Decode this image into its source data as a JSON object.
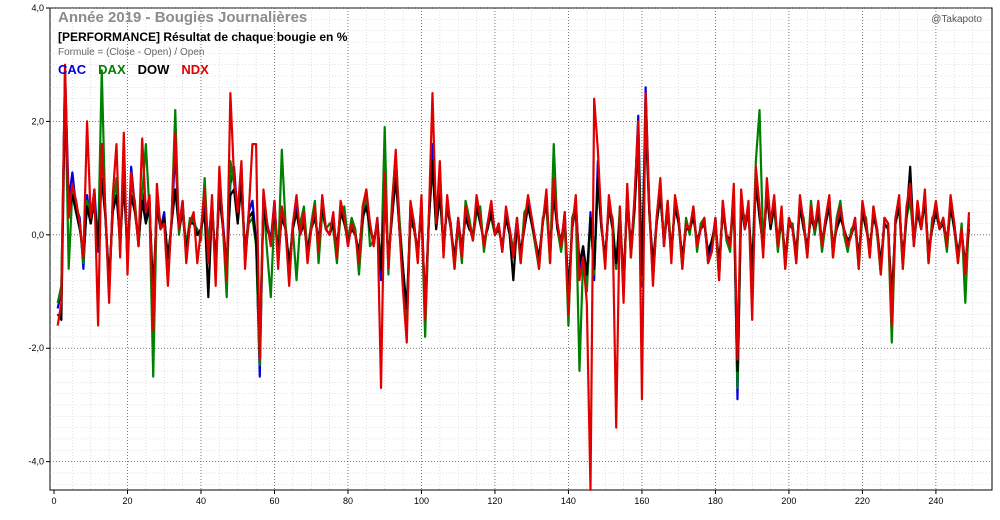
{
  "title": "Année 2019 - Bougies Journalières",
  "subtitle": "[PERFORMANCE] Résultat de chaque bougie en %",
  "formula": "Formule = (Close - Open) / Open",
  "watermark": "@Takapoto",
  "colors": {
    "CAC": "#0000dd",
    "DAX": "#008000",
    "DOW": "#000000",
    "NDX": "#e00000",
    "grid": "#c8c8c8",
    "grid_major": "#555555"
  },
  "chart_data": {
    "type": "line",
    "title": "Année 2019 - Bougies Journalières",
    "subtitle": "[PERFORMANCE] Résultat de chaque bougie en %",
    "xlim": [
      0,
      252
    ],
    "ylim": [
      -4.5,
      4.0
    ],
    "x_ticks": [
      0,
      20,
      40,
      60,
      80,
      100,
      120,
      140,
      160,
      180,
      200,
      220,
      240
    ],
    "y_ticks": [
      -4.0,
      -2.0,
      0.0,
      2.0,
      4.0
    ],
    "y_tick_labels": [
      "-4,0",
      "-2,0",
      "0,0",
      "2,0",
      "4,0"
    ],
    "grid": true,
    "legend_position": "top-left",
    "series": [
      {
        "name": "CAC",
        "color": "#0000dd",
        "values": [
          -1.3,
          -1.0,
          2.9,
          0.6,
          1.1,
          0.5,
          0.3,
          -0.6,
          0.7,
          0.2,
          0.8,
          -0.3,
          1.6,
          0.4,
          -1.0,
          0.6,
          0.9,
          -0.2,
          1.2,
          -0.5,
          1.2,
          0.5,
          -0.2,
          0.8,
          0.3,
          0.6,
          -1.4,
          0.7,
          0.1,
          0.4,
          -0.6,
          0.2,
          1.5,
          0.1,
          0.6,
          -0.4,
          0.2,
          0.3,
          0.0,
          0.1,
          0.5,
          -0.2,
          0.6,
          -0.7,
          1.0,
          0.2,
          -0.6,
          0.9,
          1.2,
          0.3,
          1.2,
          -0.5,
          0.4,
          0.6,
          -0.1,
          -2.5,
          0.7,
          0.2,
          -0.1,
          0.6,
          -0.5,
          0.4,
          0.1,
          -0.7,
          0.2,
          0.5,
          0.0,
          0.3,
          -0.4,
          0.1,
          0.4,
          -0.2,
          0.6,
          0.1,
          0.0,
          0.3,
          -0.3,
          0.5,
          0.3,
          -0.2,
          0.2,
          0.0,
          -0.4,
          0.4,
          0.6,
          0.2,
          -0.2,
          0.3,
          -0.8,
          0.9,
          -0.5,
          0.4,
          1.2,
          0.1,
          -0.8,
          -1.7,
          0.5,
          0.2,
          -0.4,
          0.6,
          -1.5,
          0.3,
          1.6,
          0.2,
          0.9,
          -0.3,
          0.6,
          0.1,
          -0.5,
          0.3,
          -0.3,
          0.4,
          0.2,
          -0.1,
          0.6,
          0.3,
          -0.2,
          0.2,
          0.5,
          0.0,
          0.2,
          -0.3,
          0.4,
          0.1,
          -0.3,
          0.3,
          -0.4,
          0.2,
          0.6,
          0.3,
          -0.1,
          -0.5,
          0.2,
          0.7,
          -0.4,
          0.9,
          0.2,
          -0.2,
          0.4,
          -1.2,
          0.1,
          0.6,
          -0.6,
          -0.3,
          -0.9,
          0.4,
          -0.8,
          1.3,
          0.2,
          -0.5,
          0.6,
          0.2,
          -0.6,
          0.4,
          -1.0,
          0.8,
          -0.3,
          0.6,
          2.1,
          -0.9,
          2.6,
          0.5,
          -0.7,
          0.3,
          0.9,
          -0.2,
          0.5,
          -0.4,
          0.6,
          0.3,
          -0.5,
          0.2,
          0.1,
          0.4,
          -0.2,
          0.1,
          0.2,
          -0.4,
          -0.2,
          0.3,
          -0.7,
          0.5,
          0.0,
          -0.2,
          0.8,
          -2.9,
          0.7,
          0.1,
          0.5,
          -0.8,
          1.1,
          0.4,
          -0.3,
          0.9,
          0.2,
          0.6,
          -0.2,
          0.4,
          -0.5,
          0.3,
          0.1,
          -0.4,
          0.6,
          0.2,
          -0.3,
          0.4,
          0.1,
          0.5,
          -0.2,
          0.3,
          0.6,
          -0.3,
          0.2,
          0.4,
          0.1,
          -0.2,
          0.0,
          0.3,
          -0.5,
          0.5,
          0.2,
          -0.3,
          0.4,
          0.1,
          -0.6,
          0.3,
          0.2,
          -1.4,
          0.3,
          0.6,
          -0.5,
          0.4,
          0.8,
          -0.2,
          0.5,
          0.1,
          0.7,
          -0.4,
          0.2,
          0.5,
          0.1,
          0.3,
          -0.2,
          0.6,
          0.2,
          -0.4,
          0.1,
          -0.6,
          0.2
        ]
      },
      {
        "name": "DAX",
        "color": "#008000",
        "values": [
          -1.2,
          -0.9,
          2.7,
          -0.6,
          0.8,
          0.6,
          0.2,
          -0.5,
          0.6,
          0.3,
          0.5,
          -0.2,
          2.9,
          0.3,
          -1.0,
          0.5,
          1.0,
          -0.3,
          1.3,
          -0.4,
          0.9,
          0.6,
          -0.2,
          0.7,
          1.6,
          0.4,
          -2.5,
          0.6,
          0.2,
          0.2,
          -0.8,
          0.3,
          2.2,
          0.0,
          0.5,
          -0.2,
          0.3,
          0.2,
          0.1,
          -0.1,
          1.0,
          -0.3,
          0.6,
          -0.6,
          0.9,
          0.1,
          -1.1,
          1.3,
          0.9,
          0.4,
          0.8,
          -0.4,
          0.2,
          0.3,
          -0.2,
          -2.3,
          0.6,
          -0.3,
          -1.1,
          0.4,
          -0.4,
          1.5,
          0.2,
          -0.6,
          0.1,
          -0.8,
          0.2,
          0.5,
          -0.3,
          0.2,
          0.6,
          -0.5,
          0.4,
          0.1,
          0.2,
          0.1,
          -0.5,
          0.4,
          0.5,
          -0.1,
          0.3,
          0.1,
          -0.7,
          0.2,
          0.8,
          -0.2,
          -0.1,
          0.2,
          -0.6,
          1.9,
          -0.7,
          0.6,
          1.4,
          0.3,
          -0.6,
          -1.5,
          0.2,
          0.1,
          -0.3,
          0.5,
          -1.8,
          0.3,
          1.2,
          0.1,
          1.1,
          -0.2,
          0.5,
          0.2,
          -0.6,
          0.2,
          -0.5,
          0.6,
          0.3,
          -0.1,
          0.4,
          0.5,
          -0.3,
          0.2,
          0.3,
          0.0,
          0.1,
          -0.2,
          0.3,
          0.1,
          -0.3,
          0.2,
          -0.5,
          0.4,
          0.5,
          0.2,
          -0.2,
          -0.6,
          0.3,
          0.5,
          -0.5,
          1.6,
          0.1,
          -0.3,
          0.2,
          -1.6,
          0.3,
          0.5,
          -2.4,
          -0.4,
          -1.0,
          0.3,
          -0.7,
          0.9,
          0.1,
          -0.4,
          0.5,
          0.3,
          -0.6,
          0.5,
          -1.0,
          0.7,
          -0.4,
          0.4,
          1.9,
          -0.8,
          2.4,
          0.4,
          -0.8,
          0.2,
          0.7,
          -0.1,
          0.6,
          -0.3,
          0.5,
          0.2,
          -0.6,
          0.3,
          0.0,
          0.5,
          -0.3,
          0.2,
          0.3,
          -0.5,
          -0.3,
          0.2,
          -0.8,
          0.6,
          -0.1,
          -0.3,
          0.7,
          -2.7,
          0.5,
          0.3,
          0.4,
          -0.7,
          1.3,
          2.2,
          -0.2,
          0.7,
          0.3,
          0.5,
          -0.3,
          0.3,
          -0.6,
          0.2,
          0.2,
          -0.5,
          0.5,
          0.3,
          -0.4,
          0.6,
          0.0,
          0.4,
          -0.3,
          0.2,
          0.5,
          -0.4,
          0.3,
          0.6,
          0.0,
          -0.3,
          0.1,
          0.2,
          -0.6,
          0.4,
          0.3,
          -0.4,
          0.5,
          0.0,
          -0.7,
          0.2,
          0.1,
          -1.9,
          0.2,
          0.5,
          -0.6,
          0.3,
          0.6,
          -0.1,
          0.4,
          0.2,
          0.6,
          -0.5,
          0.3,
          0.4,
          0.2,
          0.2,
          -0.3,
          0.5,
          0.1,
          -0.5,
          0.2,
          -1.2,
          0.3
        ]
      },
      {
        "name": "DOW",
        "color": "#000000",
        "values": [
          -1.4,
          -1.5,
          2.5,
          0.4,
          0.7,
          0.4,
          0.1,
          -0.3,
          0.5,
          0.2,
          0.6,
          -0.2,
          1.0,
          0.3,
          -0.8,
          0.4,
          0.7,
          -0.1,
          0.9,
          -0.3,
          0.7,
          0.4,
          -0.1,
          0.6,
          0.2,
          0.5,
          -1.0,
          0.5,
          0.1,
          0.3,
          -0.4,
          0.2,
          0.8,
          0.1,
          0.4,
          -0.3,
          0.2,
          0.2,
          0.0,
          0.1,
          0.4,
          -1.1,
          0.5,
          -0.5,
          0.7,
          0.1,
          -0.5,
          0.7,
          0.8,
          0.2,
          0.9,
          -0.3,
          0.3,
          0.4,
          -0.1,
          -1.8,
          0.5,
          0.1,
          -0.1,
          0.4,
          -0.3,
          0.3,
          0.1,
          -0.5,
          0.1,
          0.4,
          0.0,
          0.2,
          -0.3,
          0.1,
          0.3,
          -0.1,
          0.5,
          0.1,
          0.0,
          0.2,
          -0.2,
          0.4,
          0.2,
          -0.1,
          0.1,
          0.0,
          -0.3,
          0.3,
          0.5,
          0.1,
          -0.1,
          0.2,
          -0.6,
          0.7,
          -0.4,
          0.3,
          1.0,
          0.1,
          -0.6,
          -1.3,
          0.4,
          0.1,
          -0.3,
          0.4,
          -1.2,
          0.2,
          1.3,
          0.1,
          0.7,
          -0.2,
          0.5,
          0.1,
          -0.4,
          0.2,
          -0.2,
          0.3,
          0.1,
          0.0,
          0.5,
          0.2,
          -0.1,
          0.1,
          0.4,
          0.0,
          0.1,
          -0.2,
          0.3,
          0.0,
          -0.8,
          0.2,
          -0.3,
          0.1,
          0.5,
          0.2,
          -0.1,
          -0.4,
          0.2,
          0.6,
          -0.3,
          0.7,
          0.1,
          -0.1,
          0.3,
          -1.0,
          0.1,
          0.5,
          -0.5,
          -0.2,
          -0.7,
          0.3,
          -0.6,
          1.0,
          0.1,
          -0.4,
          0.5,
          0.1,
          -0.5,
          0.3,
          -0.8,
          0.6,
          -0.2,
          0.5,
          1.6,
          -0.7,
          2.0,
          0.4,
          -0.5,
          0.2,
          0.7,
          -0.1,
          0.4,
          -0.3,
          0.5,
          0.2,
          -0.4,
          0.1,
          0.1,
          0.3,
          -0.1,
          0.1,
          0.2,
          -0.3,
          -0.1,
          0.2,
          -0.5,
          0.4,
          0.0,
          -0.1,
          0.6,
          -2.4,
          0.5,
          0.1,
          0.4,
          -0.6,
          0.9,
          0.3,
          -0.2,
          0.7,
          0.1,
          0.5,
          -0.1,
          0.3,
          -0.4,
          0.2,
          0.1,
          -0.3,
          0.5,
          0.1,
          -0.2,
          0.3,
          0.1,
          0.4,
          -0.1,
          0.2,
          0.5,
          -0.2,
          0.1,
          0.3,
          0.1,
          -0.1,
          0.0,
          0.2,
          -0.4,
          0.4,
          0.1,
          -0.2,
          0.3,
          0.1,
          -0.5,
          0.2,
          0.1,
          -1.1,
          0.2,
          0.5,
          -0.4,
          0.3,
          1.2,
          -0.1,
          0.4,
          0.1,
          0.6,
          -0.3,
          0.1,
          0.4,
          0.1,
          0.2,
          -0.1,
          0.5,
          0.1,
          -0.3,
          0.0,
          -0.5,
          0.1
        ]
      },
      {
        "name": "NDX",
        "color": "#e00000",
        "values": [
          -1.6,
          -1.2,
          3.0,
          0.3,
          0.9,
          0.6,
          0.2,
          -0.4,
          2.0,
          0.3,
          0.8,
          -1.6,
          1.6,
          0.4,
          -1.2,
          0.7,
          1.6,
          -0.4,
          1.8,
          -0.7,
          1.1,
          0.5,
          -0.2,
          1.7,
          0.4,
          0.7,
          -1.7,
          0.9,
          0.1,
          0.2,
          -0.9,
          0.3,
          1.8,
          0.1,
          0.6,
          -0.5,
          0.2,
          0.4,
          -0.5,
          0.1,
          0.8,
          -0.5,
          0.7,
          -0.9,
          1.2,
          0.1,
          -0.8,
          2.5,
          1.0,
          0.4,
          1.3,
          -0.6,
          0.4,
          1.6,
          1.6,
          -2.2,
          0.8,
          0.2,
          -0.2,
          0.6,
          -0.6,
          0.5,
          0.1,
          -0.9,
          0.2,
          0.7,
          0.0,
          0.4,
          -0.5,
          0.1,
          0.5,
          -0.3,
          0.7,
          0.1,
          0.0,
          0.4,
          -0.4,
          0.6,
          0.3,
          -0.2,
          0.2,
          0.0,
          -0.5,
          0.5,
          0.8,
          0.2,
          -0.2,
          0.3,
          -2.7,
          1.1,
          -0.6,
          0.5,
          1.5,
          0.1,
          -1.0,
          -1.9,
          0.6,
          0.2,
          -0.5,
          0.7,
          -1.5,
          0.3,
          2.5,
          0.2,
          1.3,
          -0.4,
          0.7,
          0.1,
          -0.6,
          0.3,
          -0.4,
          0.5,
          0.2,
          -0.1,
          0.7,
          0.3,
          -0.2,
          0.2,
          0.6,
          0.0,
          0.2,
          -0.3,
          0.5,
          0.1,
          -0.4,
          0.3,
          -0.5,
          0.2,
          0.7,
          0.3,
          -0.1,
          -0.6,
          0.2,
          0.8,
          -0.5,
          1.0,
          0.2,
          -0.2,
          0.4,
          -1.4,
          0.1,
          0.7,
          -0.8,
          -0.4,
          -1.2,
          -4.5,
          2.4,
          1.5,
          0.2,
          -0.6,
          0.7,
          0.2,
          -3.4,
          0.5,
          -1.2,
          0.9,
          -0.4,
          0.7,
          2.0,
          -2.9,
          2.5,
          0.5,
          -0.9,
          0.3,
          1.0,
          -0.2,
          0.6,
          -0.5,
          0.7,
          0.3,
          -0.6,
          0.2,
          0.1,
          0.5,
          -0.2,
          0.1,
          0.3,
          -0.5,
          -0.3,
          0.3,
          -0.8,
          0.6,
          0.0,
          -0.2,
          0.9,
          -2.2,
          0.8,
          0.1,
          0.6,
          -1.5,
          1.2,
          0.5,
          -0.4,
          1.0,
          0.2,
          0.7,
          -0.2,
          0.5,
          -0.6,
          0.3,
          0.1,
          -0.5,
          0.7,
          0.2,
          -0.4,
          0.5,
          0.1,
          0.6,
          -0.2,
          0.3,
          0.7,
          -0.4,
          0.2,
          0.5,
          0.1,
          -0.2,
          0.0,
          0.3,
          -0.6,
          0.6,
          0.2,
          -0.4,
          0.5,
          0.1,
          -0.7,
          0.3,
          0.2,
          -1.6,
          0.3,
          0.7,
          -0.6,
          0.5,
          0.9,
          -0.2,
          0.6,
          0.1,
          0.8,
          -0.5,
          0.2,
          0.6,
          0.1,
          0.3,
          -0.2,
          0.7,
          0.2,
          -0.5,
          0.1,
          -0.7,
          0.4
        ]
      }
    ]
  }
}
